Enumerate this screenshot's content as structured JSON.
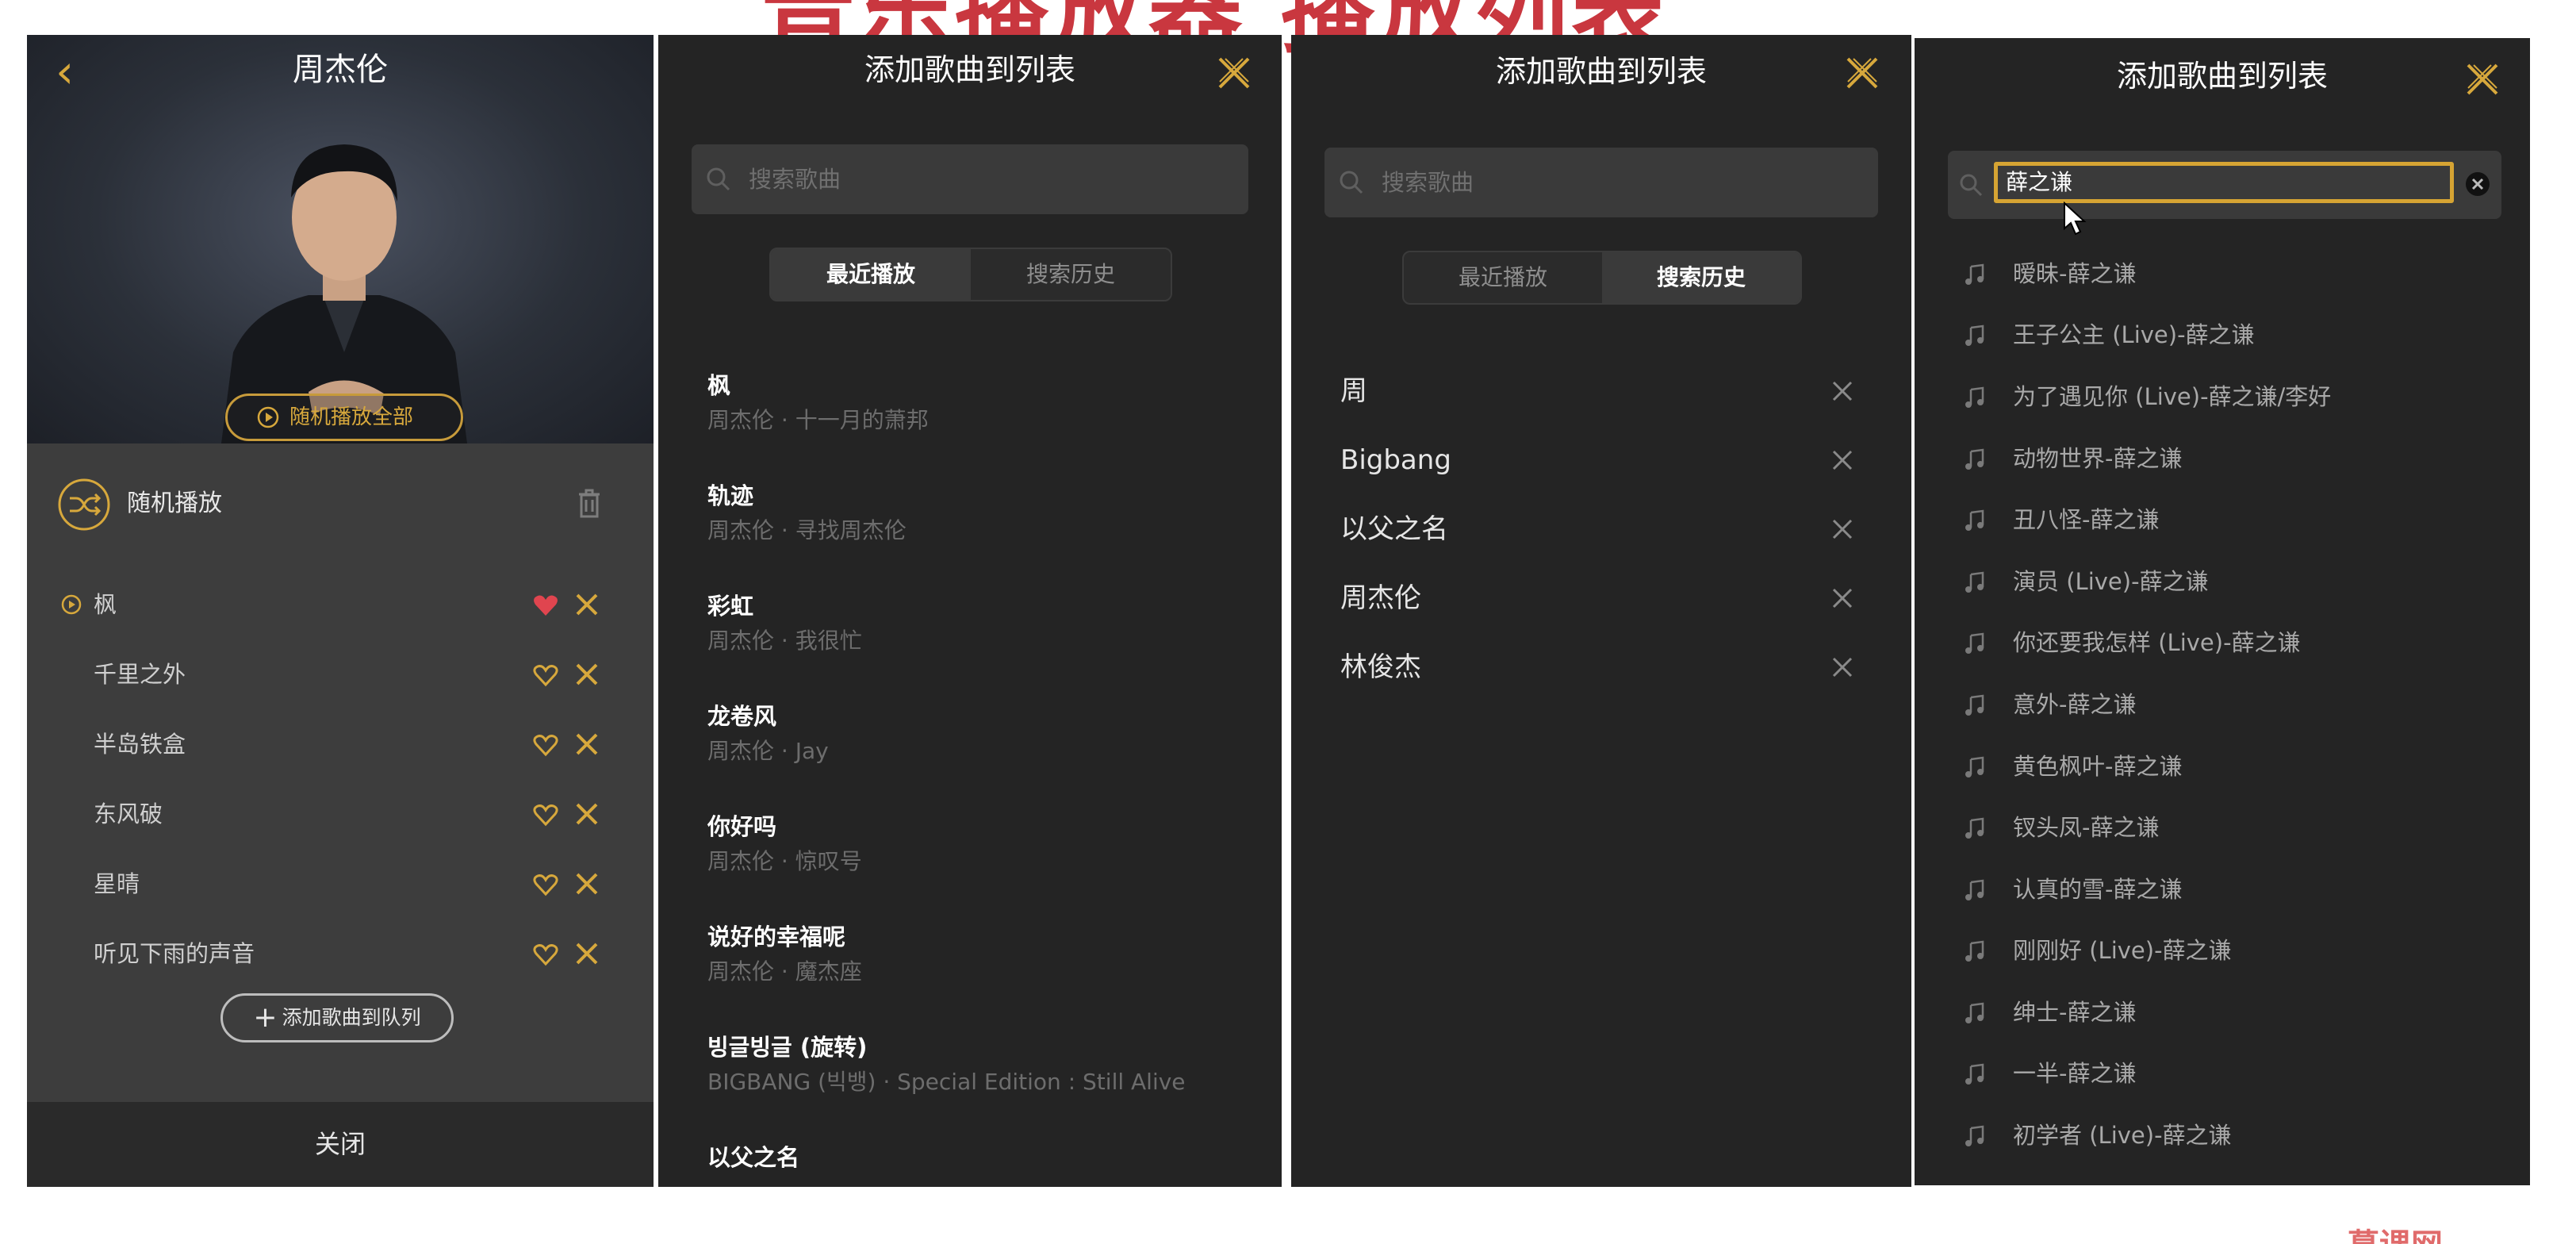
{
  "banner": {
    "title": "音乐播放器 播放列表",
    "watermark": "慕课网"
  },
  "player_panel": {
    "artist": "周杰伦",
    "play_all_label": "随机播放全部",
    "shuffle_label": "随机播放",
    "queue": [
      {
        "name": "枫",
        "liked": true,
        "playing": true
      },
      {
        "name": "千里之外",
        "liked": false,
        "playing": false
      },
      {
        "name": "半岛铁盒",
        "liked": false,
        "playing": false
      },
      {
        "name": "东风破",
        "liked": false,
        "playing": false
      },
      {
        "name": "星晴",
        "liked": false,
        "playing": false
      },
      {
        "name": "听见下雨的声音",
        "liked": false,
        "playing": false
      }
    ],
    "add_to_queue_label": "添加歌曲到队列",
    "close_label": "关闭"
  },
  "recent_panel": {
    "title": "添加歌曲到列表",
    "search_placeholder": "搜索歌曲",
    "tabs": [
      {
        "label": "最近播放",
        "active": true
      },
      {
        "label": "搜索历史",
        "active": false
      }
    ],
    "songs": [
      {
        "title": "枫",
        "subtitle": "周杰伦 · 十一月的萧邦"
      },
      {
        "title": "轨迹",
        "subtitle": "周杰伦 · 寻找周杰伦"
      },
      {
        "title": "彩虹",
        "subtitle": "周杰伦 · 我很忙"
      },
      {
        "title": "龙卷风",
        "subtitle": "周杰伦 · Jay"
      },
      {
        "title": "你好吗",
        "subtitle": "周杰伦 · 惊叹号"
      },
      {
        "title": "说好的幸福呢",
        "subtitle": "周杰伦 · 魔杰座"
      },
      {
        "title": "빙글빙글 (旋转)",
        "subtitle": "BIGBANG (빅뱅) · Special Edition : Still Alive"
      },
      {
        "title": "以父之名",
        "subtitle": ""
      }
    ]
  },
  "history_panel": {
    "title": "添加歌曲到列表",
    "search_placeholder": "搜索歌曲",
    "tabs": [
      {
        "label": "最近播放",
        "active": false
      },
      {
        "label": "搜索历史",
        "active": true
      }
    ],
    "items": [
      "周",
      "Bigbang",
      "以父之名",
      "周杰伦",
      "林俊杰"
    ]
  },
  "results_panel": {
    "title": "添加歌曲到列表",
    "search_value": "薛之谦",
    "results": [
      "暧昧-薛之谦",
      "王子公主 (Live)-薛之谦",
      "为了遇见你 (Live)-薛之谦/李好",
      "动物世界-薛之谦",
      "丑八怪-薛之谦",
      "演员 (Live)-薛之谦",
      "你还要我怎样 (Live)-薛之谦",
      "意外-薛之谦",
      "黄色枫叶-薛之谦",
      "钗头凤-薛之谦",
      "认真的雪-薛之谦",
      "刚刚好 (Live)-薛之谦",
      "绅士-薛之谦",
      "一半-薛之谦",
      "初学者 (Live)-薛之谦"
    ]
  },
  "colors": {
    "accent": "#d7a83c",
    "danger": "#e0454f",
    "panel_bg": "#242424",
    "banner": "#c9373f"
  },
  "icons": [
    "back-icon",
    "play-circle-icon",
    "shuffle-icon",
    "trash-icon",
    "heart-icon",
    "close-icon",
    "plus-icon",
    "search-icon",
    "clear-icon",
    "music-note-icon",
    "cursor-icon"
  ]
}
